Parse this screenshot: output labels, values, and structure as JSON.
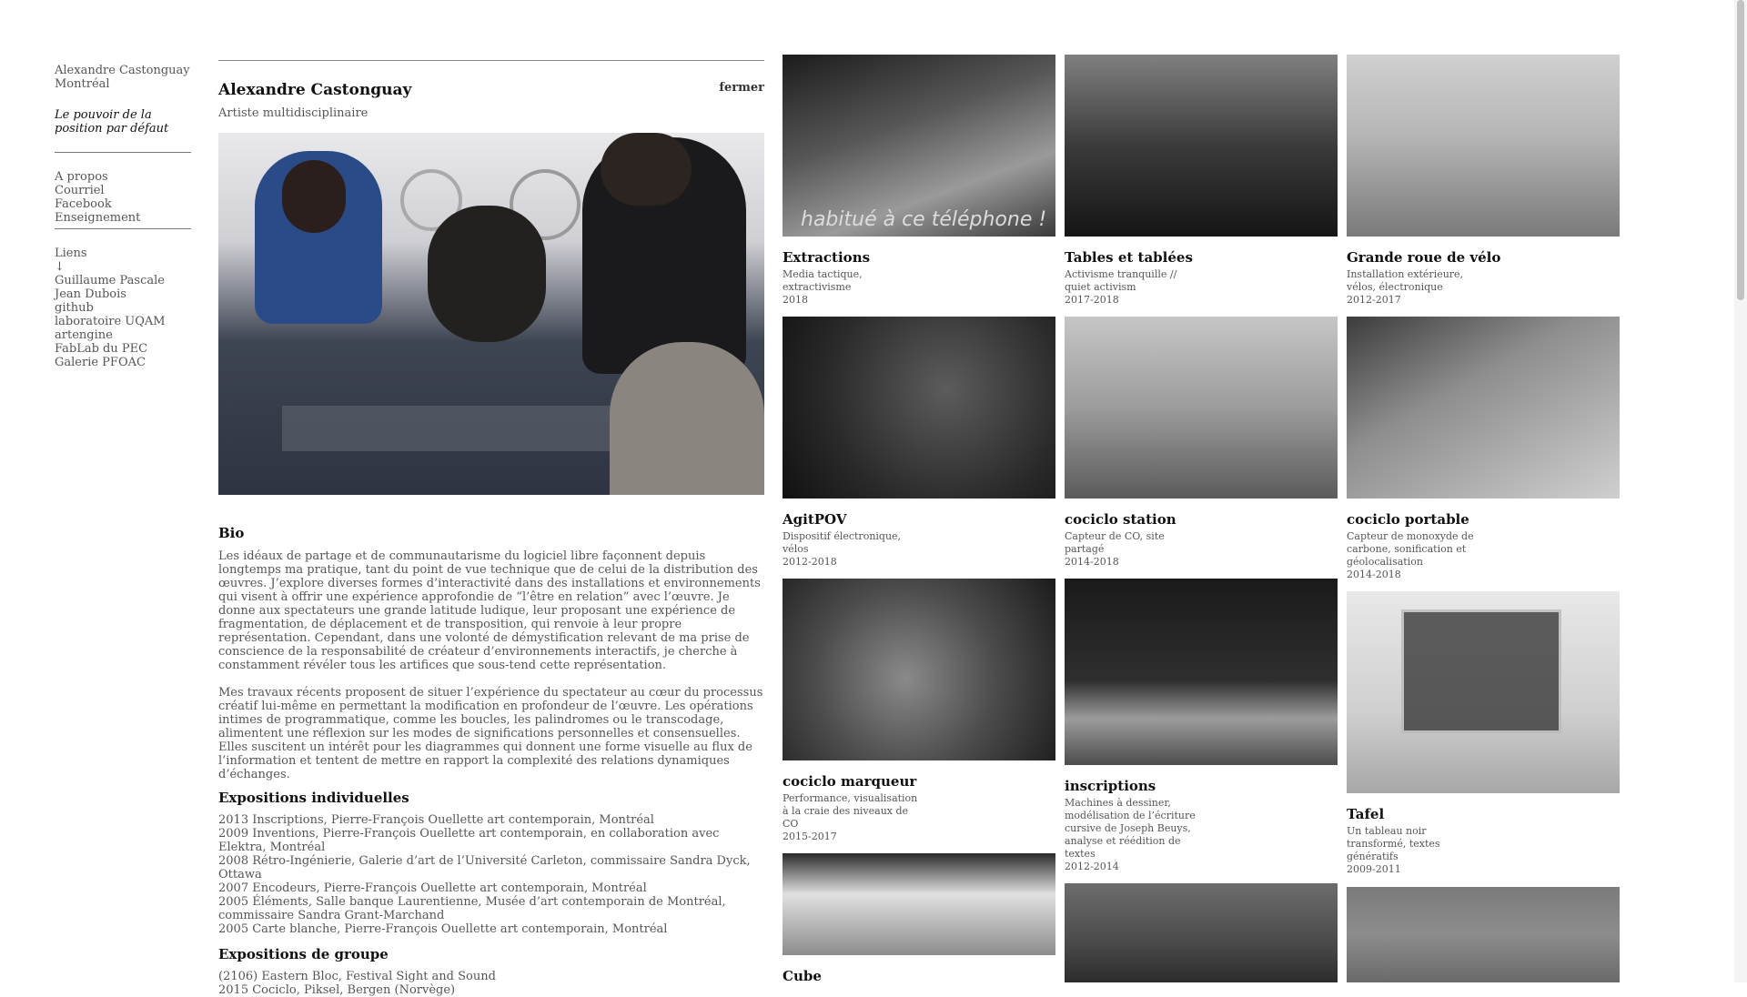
{
  "sidebar": {
    "name": "Alexandre Castonguay",
    "city": "Montréal",
    "tagline_line1": "Le pouvoir de la",
    "tagline_line2": "position par défaut",
    "nav": [
      "A propos",
      "Courriel",
      "Facebook",
      "Enseignement"
    ],
    "links_heading": "Liens",
    "links_arrow": "↓",
    "links": [
      "Guillaume Pascale",
      "Jean Dubois",
      "github",
      "laboratoire UQAM",
      "artengine",
      "FabLab du PEC",
      "Galerie PFOAC"
    ]
  },
  "article": {
    "title": "Alexandre Castonguay",
    "close_label": "fermer",
    "subtitle": "Artiste multidisciplinaire",
    "bio_heading": "Bio",
    "bio_p1": "Les idéaux de partage et de communautarisme du logiciel libre façonnent depuis longtemps ma pratique, tant du point de vue technique que de celui de la distribution des œuvres. J’explore diverses formes d’interactivité dans des installations et environnements qui visent à offrir une expérience approfondie de “l’être en relation” avec l’œuvre. Je donne aux spectateurs une grande latitude ludique, leur proposant une expérience de fragmentation, de déplacement et de transposition, qui renvoie à leur propre représentation. Cependant, dans une volonté de démystification relevant de ma prise de conscience de la responsabilité de créateur d’environnements interactifs, je cherche à constamment révéler tous les artifices que sous-tend cette représentation.",
    "bio_p2": "Mes travaux récents proposent de situer l’expérience du spectateur au cœur du processus créatif lui-même en permettant la modification en profondeur de l’œuvre. Les opérations intimes de programmatique, comme les boucles, les palindromes ou le transcodage, alimentent une réflexion sur les modes de significations personnelles et consensuelles. Elles suscitent un intérêt pour les diagrammes qui donnent une forme visuelle au flux de l’information et tentent de mettre en rapport la complexité des relations dynamiques d’échanges.",
    "expo_heading": "Expositions individuelles",
    "expo_list": [
      "2013 Inscriptions, Pierre-François Ouellette art contemporain, Montréal",
      "2009 Inventions, Pierre-François Ouellette art contemporain, en collaboration avec Elektra, Montréal",
      "2008 Rétro-Ingénierie, Galerie d’art de l’Université Carleton, commissaire Sandra Dyck, Ottawa",
      "2007 Encodeurs, Pierre-François Ouellette art contemporain, Montréal",
      "2005 Éléments, Salle banque Laurentienne, Musée d’art contemporain de Montréal, commissaire Sandra Grant-Marchand",
      "2005 Carte blanche, Pierre-François Ouellette art contemporain, Montréal"
    ],
    "group_heading": "Expositions de groupe",
    "group_list": [
      "(2106) Eastern Bloc, Festival Sight and Sound",
      "2015 Cociclo, Piksel, Bergen (Norvège)"
    ]
  },
  "projects": [
    {
      "title": "Extractions",
      "desc": [
        "Media tactique,",
        "extractivisme",
        "2018"
      ],
      "overlay_text": "habitué à ce téléphone !"
    },
    {
      "title": "Tables et tablées",
      "desc": [
        "Activisme tranquille //",
        "quiet activism",
        "2017-2018"
      ]
    },
    {
      "title": "Grande roue de vélo",
      "desc": [
        "Installation extérieure,",
        "vélos, électronique",
        "2012-2017"
      ]
    },
    {
      "title": "AgitPOV",
      "desc": [
        "Dispositif électronique,",
        "vélos",
        "2012-2018"
      ]
    },
    {
      "title": "cociclo station",
      "desc": [
        "Capteur de CO, site",
        "partagé",
        "2014-2018"
      ]
    },
    {
      "title": "cociclo portable",
      "desc": [
        "Capteur de monoxyde de",
        "carbone, sonification et",
        "géolocalisation",
        "2014-2018"
      ]
    },
    {
      "title": "cociclo marqueur",
      "desc": [
        "Performance, visualisation",
        "à la craie des niveaux de",
        "CO",
        "2015-2017"
      ]
    },
    {
      "title": "inscriptions",
      "desc": [
        "Machines à dessiner,",
        "modélisation de l’écriture",
        "cursive de Joseph Beuys,",
        "analyse et réédition de",
        "textes",
        "2012-2014"
      ]
    },
    {
      "title": "Tafel",
      "desc": [
        "Un tableau noir",
        "transformé, textes",
        "génératifs",
        "2009-2011"
      ]
    },
    {
      "title": "Cube",
      "desc": []
    }
  ]
}
